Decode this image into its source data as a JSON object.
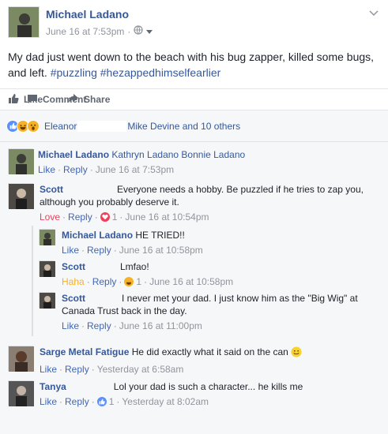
{
  "post": {
    "author": "Michael Ladano",
    "timestamp": "June 16 at 7:53pm",
    "separator": "·",
    "text_main": "My dad just went down to the beach with his bug zapper, killed some bugs, and left. ",
    "hashtag1": "#puzzling",
    "hashtag2": "#hezappedhimselfearlier"
  },
  "actions": {
    "like": "Like",
    "comment": "Comment",
    "share": "Share"
  },
  "reactions": {
    "summary_a": "Eleanor",
    "summary_b": " Mike Devine and 10 others"
  },
  "comments": [
    {
      "name": "Michael Ladano",
      "text": " Kathryn Ladano Bonnie Ladano",
      "like": "Like",
      "reply": "Reply",
      "time": "June 16 at 7:53pm"
    },
    {
      "name": "Scott",
      "text": "Everyone needs a hobby. Be puzzled if he tries to zap you, although you probably deserve it.",
      "reaction": "Love",
      "reply": "Reply",
      "count": "1",
      "time": "June 16 at 10:54pm"
    },
    {
      "name": "Michael Ladano",
      "text": " HE TRIED!!",
      "like": "Like",
      "reply": "Reply",
      "time": "June 16 at 10:58pm"
    },
    {
      "name": "Scott",
      "text": "Lmfao!",
      "reaction": "Haha",
      "reply": "Reply",
      "count": "1",
      "time": "June 16 at 10:58pm"
    },
    {
      "name": "Scott",
      "text": "I never met your dad. I just know him as the \"Big Wig\" at Canada Trust back in the day.",
      "like": "Like",
      "reply": "Reply",
      "time": "June 16 at 11:00pm"
    },
    {
      "name": "Sarge Metal Fatigue",
      "text": " He did exactly what it said on the can",
      "like": "Like",
      "reply": "Reply",
      "time": "Yesterday at 6:58am"
    },
    {
      "name": "Tanya",
      "text": "Lol your dad is such a character... he kills me",
      "like": "Like",
      "reply": "Reply",
      "count": "1",
      "time": "Yesterday at 8:02am"
    }
  ],
  "colors": {
    "link": "#365899",
    "muted": "#90949c",
    "love": "#f33e58",
    "haha": "#f7b125",
    "like": "#5890ff"
  }
}
